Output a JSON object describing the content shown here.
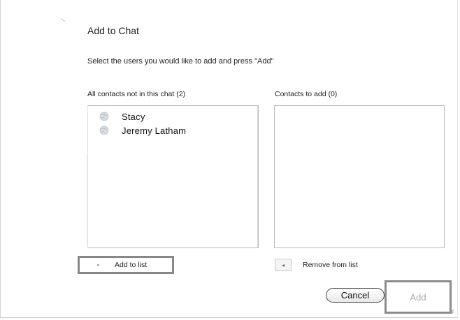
{
  "dialog": {
    "title": "Add to Chat",
    "instructions": "Select the users you would like to add and press \"Add\""
  },
  "lists": {
    "available": {
      "label": "All contacts not in this chat (2)",
      "items": [
        {
          "name": "Stacy",
          "icon": "contact-globe-icon"
        },
        {
          "name": "Jeremy Latham",
          "icon": "contact-globe-icon"
        }
      ]
    },
    "selected": {
      "label": "Contacts to add (0)",
      "items": []
    }
  },
  "actions": {
    "add_to_list": "Add to list",
    "remove_from_list": "Remove from list",
    "cancel": "Cancel",
    "add": "Add"
  },
  "colors": {
    "highlight_border": "#888888",
    "disabled_text": "#aaaaaa"
  }
}
